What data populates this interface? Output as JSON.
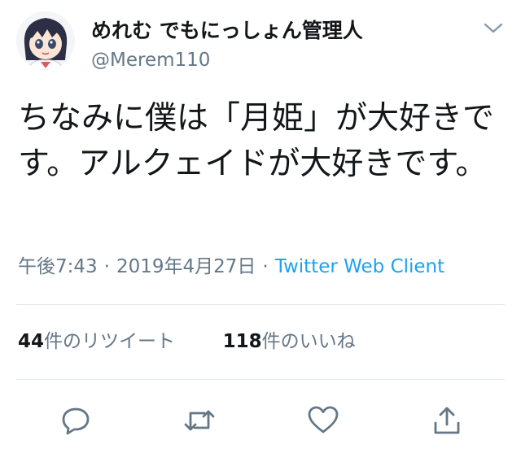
{
  "author": {
    "display_name": "めれむ でもにっしょん管理人",
    "handle": "@Merem110",
    "avatar_icon": "anime-avatar-icon"
  },
  "tweet": {
    "text": "ちなみに僕は「月姫」が大好きです。アルクェイドが大好きです。"
  },
  "meta": {
    "time": "午後7:43",
    "date": "2019年4月27日",
    "separator": "·",
    "source": "Twitter Web Client"
  },
  "stats": {
    "retweets_count": "44",
    "retweets_label": "件のリツイート",
    "likes_count": "118",
    "likes_label": "件のいいね"
  },
  "actions": [
    "reply-icon",
    "retweet-icon",
    "like-icon",
    "share-icon"
  ],
  "colors": {
    "text": "#14171a",
    "secondary": "#657786",
    "link": "#1da1f2",
    "divider": "#e1e8ed"
  }
}
